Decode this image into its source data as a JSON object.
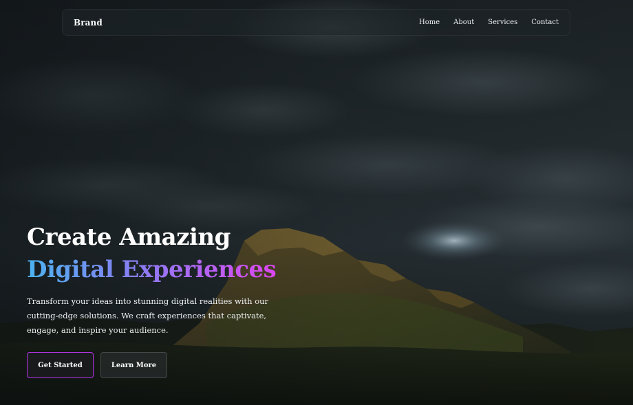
{
  "navbar": {
    "brand": "Brand",
    "links": [
      {
        "label": "Home"
      },
      {
        "label": "About"
      },
      {
        "label": "Services"
      },
      {
        "label": "Contact"
      }
    ]
  },
  "hero": {
    "title_line1": "Create Amazing",
    "title_line2": "Digital Experiences",
    "description": "Transform your ideas into stunning digital realities with our cutting-edge solutions. We craft experiences that captivate, engage, and inspire your audience.",
    "primary_button": "Get Started",
    "secondary_button": "Learn More"
  },
  "colors": {
    "gradient_start": "#4cb3f0",
    "gradient_mid": "#8b7cf2",
    "gradient_end": "#d946ef",
    "primary_border": "#b533e8"
  },
  "background": {
    "description_icon": "mountain-landscape-image"
  }
}
